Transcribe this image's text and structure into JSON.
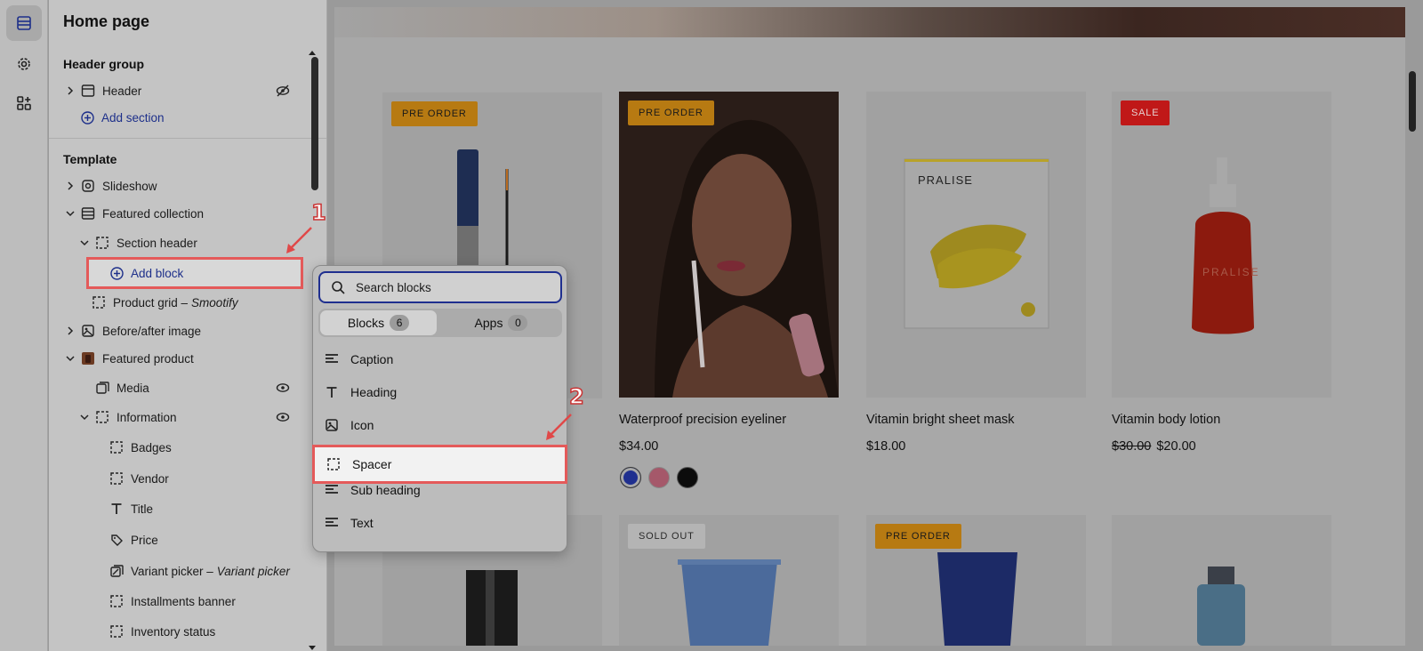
{
  "sidebar": {
    "title": "Home page",
    "header_group": {
      "title": "Header group",
      "items": [
        {
          "label": "Header"
        }
      ],
      "add_section": "Add section"
    },
    "template": {
      "title": "Template",
      "slideshow": "Slideshow",
      "featured_collection": "Featured collection",
      "section_header": "Section header",
      "add_block": "Add block",
      "product_grid": "Product grid –",
      "product_grid_app": "Smootify",
      "before_after": "Before/after image",
      "featured_product": "Featured product",
      "media": "Media",
      "information": "Information",
      "badges": "Badges",
      "vendor": "Vendor",
      "title_block": "Title",
      "price": "Price",
      "variant_picker": "Variant picker –",
      "variant_picker_sub": "Variant picker",
      "installments": "Installments banner",
      "inventory": "Inventory status"
    }
  },
  "annotations": {
    "one": "1",
    "two": "2"
  },
  "popover": {
    "search_placeholder": "Search blocks",
    "tabs": [
      {
        "label": "Blocks",
        "count": "6"
      },
      {
        "label": "Apps",
        "count": "0"
      }
    ],
    "items": [
      {
        "label": "Caption",
        "icon": "text-lines-icon"
      },
      {
        "label": "Heading",
        "icon": "heading-t-icon"
      },
      {
        "label": "Icon",
        "icon": "image-icon"
      },
      {
        "label": "Spacer",
        "icon": "spacer-dashed-icon"
      },
      {
        "label": "Sub heading",
        "icon": "text-lines-icon"
      },
      {
        "label": "Text",
        "icon": "text-lines-icon"
      }
    ]
  },
  "products": [
    {
      "badge": "PRE ORDER",
      "name": "",
      "price": ""
    },
    {
      "badge": "PRE ORDER",
      "name": "Waterproof precision eyeliner",
      "price": "$34.00"
    },
    {
      "badge": "",
      "name": "Vitamin bright sheet mask",
      "price": "$18.00",
      "package_brand": "PRALISE"
    },
    {
      "badge": "SALE",
      "name": "Vitamin body lotion",
      "compare_price": "$30.00",
      "price": "$20.00",
      "bottle_brand": "PRALISE"
    }
  ],
  "products_row2": [
    {
      "badge": ""
    },
    {
      "badge": "SOLD OUT"
    },
    {
      "badge": "PRE ORDER"
    },
    {
      "badge": ""
    }
  ],
  "colors": {
    "accent": "#1d2f8a",
    "highlight": "#e45a5a",
    "preorder": "#b77a12",
    "sale": "#c01818"
  }
}
